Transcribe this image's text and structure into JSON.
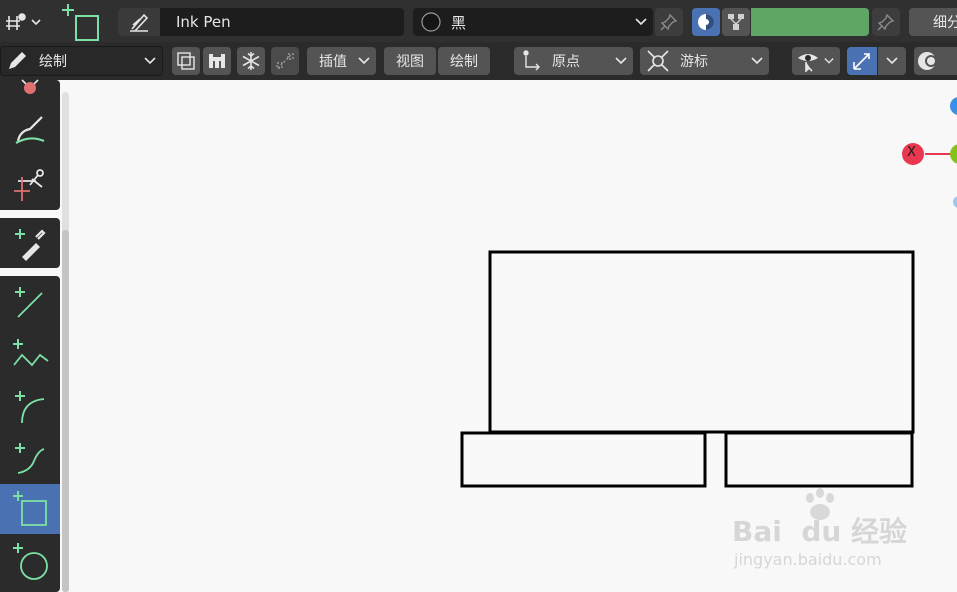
{
  "header": {
    "brush_name": "Ink Pen",
    "material_name": "黑",
    "subdivision_label": "细分",
    "color_swatch": "#5fa566"
  },
  "toolbar": {
    "mode_label": "绘制",
    "interpolate_label": "插值",
    "view_label": "视图",
    "draw_label": "绘制",
    "origin_label": "原点",
    "cursor_label": "游标"
  },
  "gizmo": {
    "x_axis_label": "X"
  },
  "watermark": {
    "logo_text": "Bai  du 经验",
    "url": "jingyan.baidu.com"
  },
  "colors": {
    "accent_green": "#7ce0a4",
    "active_blue": "#4a72b3",
    "axis_x": "#e8374f",
    "axis_y": "#86c11b",
    "axis_z": "#3a8fe6"
  },
  "tools": [
    {
      "name": "erase-tool-icon"
    },
    {
      "name": "tint-tool-icon"
    },
    {
      "name": "cutter-tool-icon"
    },
    {
      "name": "eyedropper-tool-icon"
    },
    {
      "name": "line-tool-icon"
    },
    {
      "name": "polyline-tool-icon"
    },
    {
      "name": "arc-tool-icon"
    },
    {
      "name": "curve-tool-icon"
    },
    {
      "name": "box-tool-icon"
    },
    {
      "name": "circle-tool-icon"
    }
  ]
}
